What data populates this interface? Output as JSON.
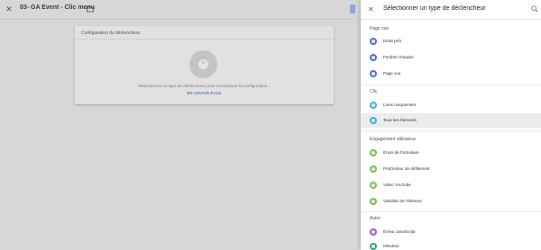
{
  "editor": {
    "title": "03- GA Event - Clic menu",
    "card": {
      "header": "Configuration du déclencheur",
      "message": "Sélectionnez un type de déclencheur pour commencer la configuration...",
      "link": "EN SAVOIR PLUS"
    }
  },
  "panel": {
    "title": "Sélectionner un type de déclencheur",
    "sections": [
      {
        "title": "Page vue",
        "items": [
          {
            "label": "DOM prêt",
            "icon": "page-view-icon",
            "color": "#4d74c9"
          },
          {
            "label": "Fenêtre chargée",
            "icon": "page-view-icon",
            "color": "#4d74c9"
          },
          {
            "label": "Page vue",
            "icon": "page-view-icon",
            "color": "#4d74c9"
          }
        ]
      },
      {
        "title": "Clic",
        "items": [
          {
            "label": "Liens uniquement",
            "icon": "link-click-icon",
            "color": "#3bb3dd"
          },
          {
            "label": "Tous les éléments",
            "icon": "click-icon",
            "color": "#3bb3dd",
            "selected": true
          }
        ]
      },
      {
        "title": "Engagement utilisateur",
        "items": [
          {
            "label": "Envoi de formulaire",
            "icon": "form-icon",
            "color": "#7cc246"
          },
          {
            "label": "Profondeur de défilement",
            "icon": "scroll-icon",
            "color": "#7cc246"
          },
          {
            "label": "Vidéo YouTube",
            "icon": "video-icon",
            "color": "#7cc246"
          },
          {
            "label": "Visibilité de l'élément",
            "icon": "visibility-icon",
            "color": "#7cc246"
          }
        ]
      },
      {
        "title": "Autre",
        "items": [
          {
            "label": "Erreur JavaScript",
            "icon": "javascript-error-icon",
            "color": "#9d5bc9"
          },
          {
            "label": "Minuteur",
            "icon": "timer-icon",
            "color": "#2fae74"
          }
        ]
      }
    ]
  }
}
